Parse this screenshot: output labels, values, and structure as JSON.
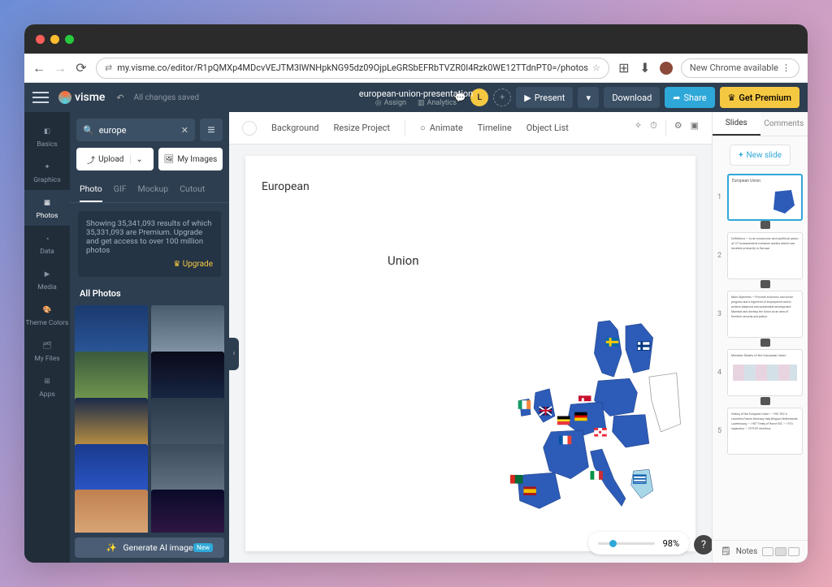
{
  "chrome": {
    "url": "my.visme.co/editor/R1pQMXp4MDcvVEJTM3lWNHpkNG95dz09OjpLeGRSbEFRbTVZR0I4Rzk0WE12TTdnPT0=/photos",
    "newChrome": "New Chrome available"
  },
  "topbar": {
    "brand": "visme",
    "autosave": "All changes saved",
    "docname": "european-union-presentation",
    "assign": "Assign",
    "analytics": "Analytics",
    "userInitial": "L",
    "present": "Present",
    "download": "Download",
    "share": "Share",
    "premium": "Get Premium"
  },
  "rail": {
    "items": [
      "Basics",
      "Graphics",
      "Photos",
      "Data",
      "Media",
      "Theme Colors",
      "My Files",
      "Apps"
    ]
  },
  "leftpanel": {
    "searchValue": "europe",
    "upload": "Upload",
    "myImages": "My Images",
    "tabs": [
      "Photo",
      "GIF",
      "Mockup",
      "Cutout"
    ],
    "info": "Showing 35,341,093 results of which 35,331,093 are Premium. Upgrade and get access to over 100 million photos",
    "upgrade": "Upgrade",
    "allPhotos": "All Photos",
    "genAI": "Generate AI image",
    "genAIBadge": "New"
  },
  "canvasToolbar": {
    "background": "Background",
    "resize": "Resize Project",
    "animate": "Animate",
    "timeline": "Timeline",
    "objectList": "Object List"
  },
  "slide": {
    "t1": "European",
    "t2": "Union"
  },
  "zoom": {
    "value": "98%"
  },
  "rightpanel": {
    "tabs": [
      "Slides",
      "Comments"
    ],
    "newSlide": "New slide",
    "slides": [
      {
        "n": "1",
        "preview": "European Union"
      },
      {
        "n": "2",
        "preview": "Definition — Is an economic and political union of 27 independent member states which are located primarily in Europe"
      },
      {
        "n": "3",
        "preview": "Main Objectives — Promote economic and social progress and a high level of employment and to achieve balanced and sustainable development. Maintain and develop the Union as an area of freedom security and justice."
      },
      {
        "n": "4",
        "preview": "Member States of the European Union"
      },
      {
        "n": "5",
        "preview": "History of the European Union — 1951 EEC 6 countries France Germany Italy Belgium Netherlands Luxembourg — 1957 Treaty of Rome EEC — 1973 expansion — 1979 EP elections"
      }
    ],
    "notes": "Notes"
  }
}
